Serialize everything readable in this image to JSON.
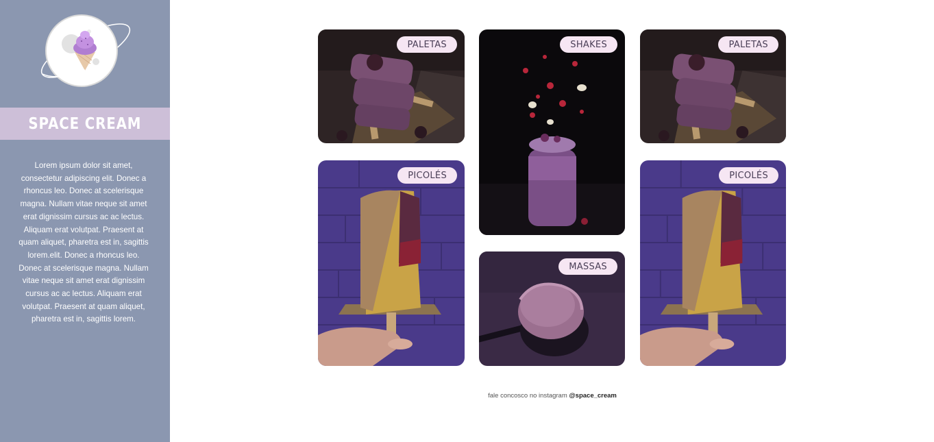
{
  "brand": {
    "name": "SPACE CREAM",
    "logo_icon": "ice-cream-planet-icon"
  },
  "sidebar": {
    "description": "Lorem ipsum dolor sit amet, consectetur adipiscing elit. Donec a rhoncus leo. Donec at scelerisque magna. Nullam vitae neque sit amet erat dignissim cursus ac ac lectus. Aliquam erat volutpat. Praesent at quam aliquet, pharetra est in, sagittis lorem.elit. Donec a rhoncus leo. Donec at scelerisque magna. Nullam vitae neque sit amet erat dignissim cursus ac ac lectus. Aliquam erat volutpat. Praesent at quam aliquet, pharetra est in, sagittis lorem."
  },
  "gallery": {
    "cards": [
      {
        "label": "PALETAS",
        "image": "popsicle-berry-photo"
      },
      {
        "label": "PICOLÉS",
        "image": "popsicle-nuts-photo"
      },
      {
        "label": "SHAKES",
        "image": "berry-shake-photo"
      },
      {
        "label": "MASSAS",
        "image": "ice-cream-scoop-photo"
      },
      {
        "label": "PALETAS",
        "image": "popsicle-berry-photo"
      },
      {
        "label": "PICOLÉS",
        "image": "popsicle-nuts-photo"
      }
    ]
  },
  "footer": {
    "text": "fale concosco no instagram",
    "handle": "@space_cream"
  },
  "colors": {
    "sidebar": "#8b97b0",
    "brand_bar": "#cdbfd8",
    "tag_bg": "#f6e6f3"
  }
}
